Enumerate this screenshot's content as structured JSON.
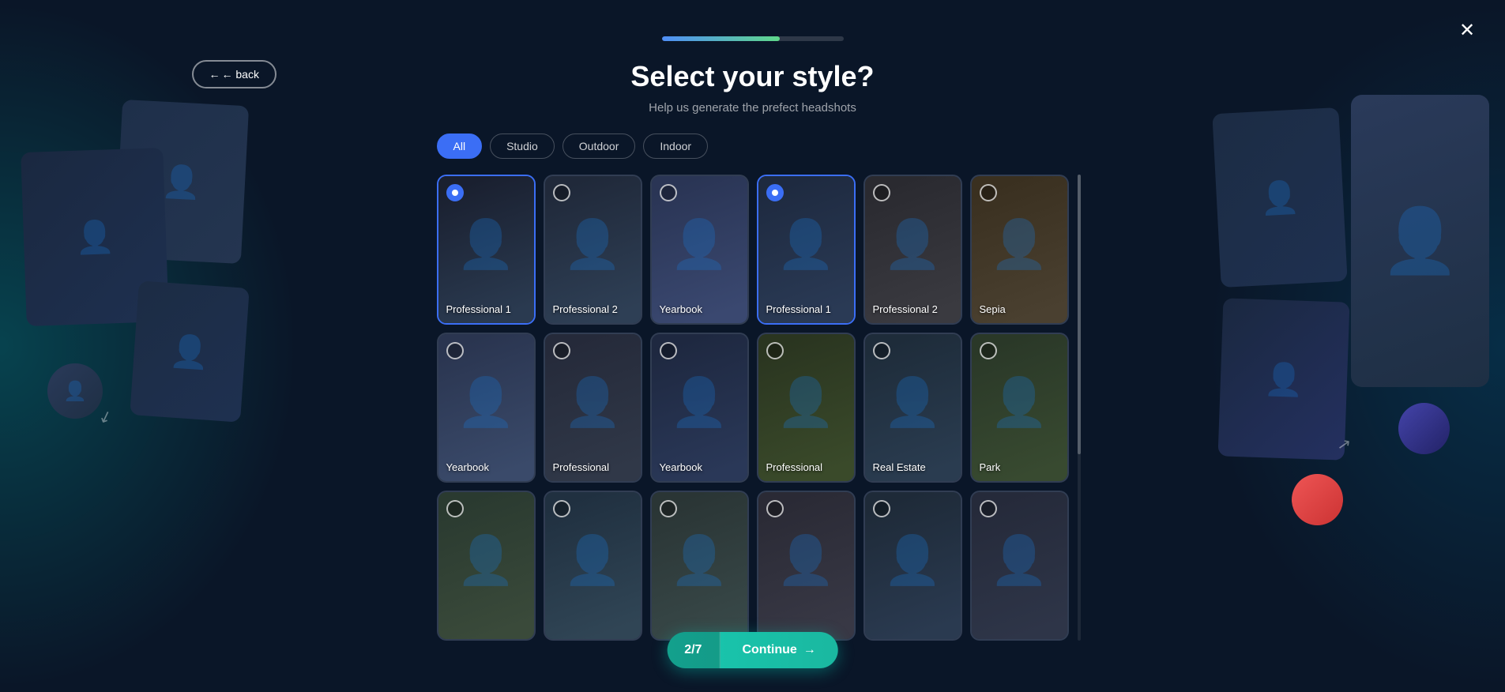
{
  "page": {
    "title": "Select your style?",
    "subtitle": "Help us generate the prefect headshots"
  },
  "progress": {
    "fill_percent": 65,
    "step_label": "2/7"
  },
  "back_button": {
    "label": "← back"
  },
  "close_button": {
    "label": "✕"
  },
  "filter_tabs": [
    {
      "id": "all",
      "label": "All",
      "active": true
    },
    {
      "id": "studio",
      "label": "Studio",
      "active": false
    },
    {
      "id": "outdoor",
      "label": "Outdoor",
      "active": false
    },
    {
      "id": "indoor",
      "label": "Indoor",
      "active": false
    }
  ],
  "style_cards": [
    {
      "id": 1,
      "label": "Professional 1",
      "photo_class": "man-suit-dark",
      "selected": true,
      "row": 1
    },
    {
      "id": 2,
      "label": "Professional 2",
      "photo_class": "man-suit-dark2",
      "selected": false,
      "row": 1
    },
    {
      "id": 3,
      "label": "Yearbook",
      "photo_class": "man-yearbook",
      "selected": false,
      "row": 1
    },
    {
      "id": 4,
      "label": "Professional 1",
      "photo_class": "woman-suit",
      "selected": true,
      "row": 1
    },
    {
      "id": 5,
      "label": "Professional 2",
      "photo_class": "woman-prof2",
      "selected": false,
      "row": 1
    },
    {
      "id": 6,
      "label": "Sepia",
      "photo_class": "woman-sepia",
      "selected": false,
      "row": 1
    },
    {
      "id": 7,
      "label": "Yearbook",
      "photo_class": "woman-yearbook2",
      "selected": false,
      "row": 2
    },
    {
      "id": 8,
      "label": "Professional",
      "photo_class": "woman-prof3",
      "selected": false,
      "row": 2
    },
    {
      "id": 9,
      "label": "Yearbook",
      "photo_class": "woman-yearbook3",
      "selected": false,
      "row": 2
    },
    {
      "id": 10,
      "label": "Professional",
      "photo_class": "man-outdoor",
      "selected": false,
      "row": 2
    },
    {
      "id": 11,
      "label": "Real Estate",
      "photo_class": "man-realestate",
      "selected": false,
      "row": 2
    },
    {
      "id": 12,
      "label": "Park",
      "photo_class": "man-park",
      "selected": false,
      "row": 2
    },
    {
      "id": 13,
      "label": "",
      "photo_class": "man-outdoor2",
      "selected": false,
      "row": 3
    },
    {
      "id": 14,
      "label": "",
      "photo_class": "man-beach",
      "selected": false,
      "row": 3
    },
    {
      "id": 15,
      "label": "",
      "photo_class": "woman-outdoor",
      "selected": false,
      "row": 3
    },
    {
      "id": 16,
      "label": "",
      "photo_class": "man-casual",
      "selected": false,
      "row": 3
    },
    {
      "id": 17,
      "label": "",
      "photo_class": "woman-outdoor2",
      "selected": false,
      "row": 3
    },
    {
      "id": 18,
      "label": "",
      "photo_class": "man-studio2",
      "selected": false,
      "row": 3
    }
  ],
  "continue": {
    "count": "2/7",
    "label": "Continue",
    "arrow": "→"
  }
}
